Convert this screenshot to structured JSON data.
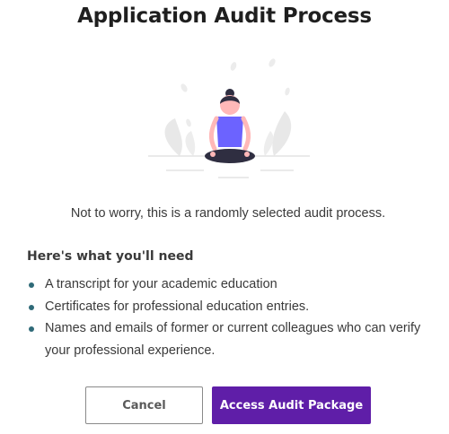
{
  "dialog": {
    "title": "Application Audit Process",
    "message": "Not to worry, this is a randomly selected audit process."
  },
  "requirements": {
    "heading": "Here's what you'll need",
    "items": [
      "A transcript for your academic education",
      "Certificates for professional education entries.",
      "Names and emails of former or current colleagues who can verify your professional experience."
    ]
  },
  "actions": {
    "cancel_label": "Cancel",
    "primary_label": "Access Audit Package"
  },
  "illustration": {
    "name": "meditating-person",
    "colors": {
      "shirt": "#6c63ff",
      "hair": "#2f2e41",
      "skin": "#ffb8b8",
      "leaves": "#e8e8e8"
    }
  },
  "colors": {
    "primary_button": "#5f1ea8",
    "bullet": "#2f6a78"
  }
}
